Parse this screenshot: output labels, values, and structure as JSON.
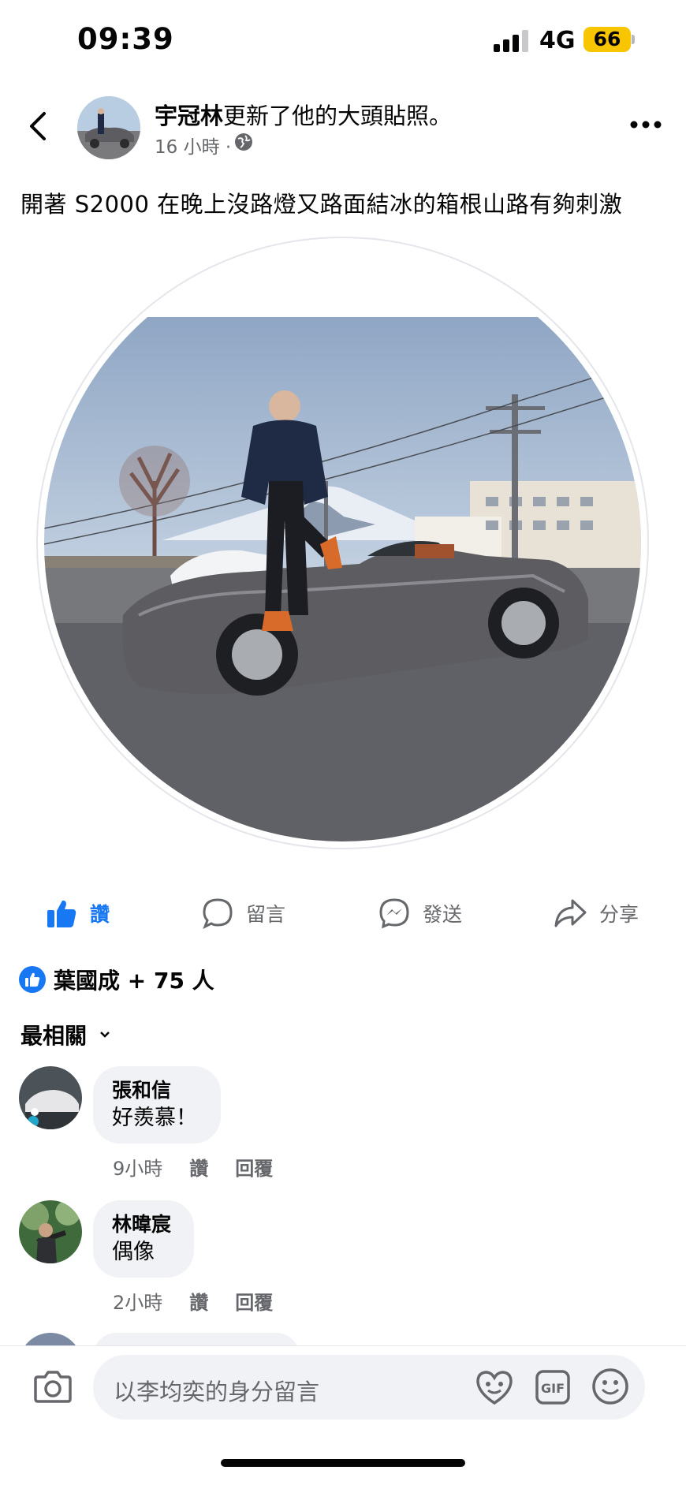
{
  "status_bar": {
    "time": "09:39",
    "network": "4G",
    "battery": "66"
  },
  "post": {
    "author": "宇冠林",
    "action": "更新了他的大頭貼照。",
    "time": "16 小時",
    "separator": "·",
    "text": "開著 S2000 在晚上沒路燈又路面結冰的箱根山路有夠刺激"
  },
  "actions": {
    "like": "讚",
    "comment": "留言",
    "send": "發送",
    "share": "分享"
  },
  "reactions": {
    "summary": "葉國成 + 75 人"
  },
  "sort": {
    "label": "最相關"
  },
  "comments": [
    {
      "name": "張和信",
      "text": "好羨慕！",
      "time": "9小時",
      "like": "讚",
      "reply": "回覆"
    },
    {
      "name": "林暐宸",
      "text": "偶像",
      "time": "2小時",
      "like": "讚",
      "reply": "回覆"
    }
  ],
  "composer": {
    "placeholder": "以李均奕的身分留言"
  },
  "icons": {
    "back": "chevron-left-icon",
    "more": "more-horizontal-icon",
    "globe": "globe-icon",
    "like": "thumbs-up-icon",
    "comment": "comment-bubble-icon",
    "send": "messenger-icon",
    "share": "share-arrow-icon",
    "camera": "camera-icon",
    "avatar_sticker": "heart-face-icon",
    "gif": "gif-icon",
    "emoji": "smiley-icon"
  },
  "colors": {
    "accent": "#1877f2",
    "battery": "#f7c600",
    "bubble": "#f0f2f5",
    "secondary_text": "#65676b"
  }
}
